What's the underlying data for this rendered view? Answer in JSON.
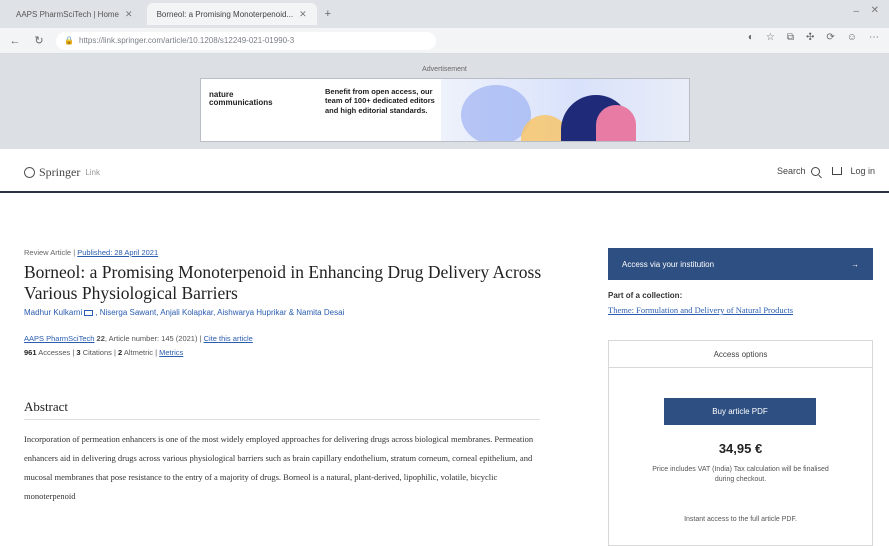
{
  "browser": {
    "tabs": [
      {
        "label": "AAPS PharmSciTech | Home"
      },
      {
        "label": "Borneol: a Promising Monoterpenoid..."
      }
    ],
    "url": "https://link.springer.com/article/10.1208/s12249-021-01990-3",
    "new_tab": "+"
  },
  "ad": {
    "label": "Advertisement",
    "logo_line1": "nature",
    "logo_line2": "communications",
    "text": "Benefit from open access, our team of 100+ dedicated editors and high editorial standards."
  },
  "header": {
    "logo_text": "Springer",
    "logo_suffix": "Link",
    "search_label": "Search",
    "login_label": "Log in"
  },
  "article": {
    "type": "Review Article",
    "published": "Published: 28 April 2021",
    "title": "Borneol: a Promising Monoterpenoid in Enhancing Drug Delivery Across Various Physiological Barriers",
    "authors": [
      "Madhur Kulkarni",
      "Niserga Sawant",
      "Anjali Kolapkar",
      "Aishwarya Huprikar",
      "Namita Desai"
    ],
    "journal": "AAPS PharmSciTech",
    "volume": "22",
    "article_number": "Article number: 145 (2021)",
    "cite": "Cite this article",
    "accesses_num": "961",
    "accesses_label": "Accesses",
    "citations_num": "3",
    "citations_label": "Citations",
    "altmetric_num": "2",
    "altmetric_label": "Altmetric",
    "metrics_link": "Metrics"
  },
  "abstract": {
    "heading": "Abstract",
    "text": "Incorporation of permeation enhancers is one of the most widely employed approaches for delivering drugs across biological membranes. Permeation enhancers aid in delivering drugs across various physiological barriers such as brain capillary endothelium, stratum corneum, corneal epithelium, and mucosal membranes that pose resistance to the entry of a majority of drugs. Borneol is a natural, plant-derived, lipophilic, volatile, bicyclic monoterpenoid"
  },
  "sidebar": {
    "access_button": "Access via your institution",
    "collection_label": "Part of a collection:",
    "collection_link": "Theme: Formulation and Delivery of Natural Products",
    "options_heading": "Access options",
    "buy_button": "Buy article PDF",
    "price": "34,95 €",
    "tax_note": "Price includes VAT (India) Tax calculation will be finalised during checkout.",
    "instant_access": "Instant access to the full article PDF."
  }
}
